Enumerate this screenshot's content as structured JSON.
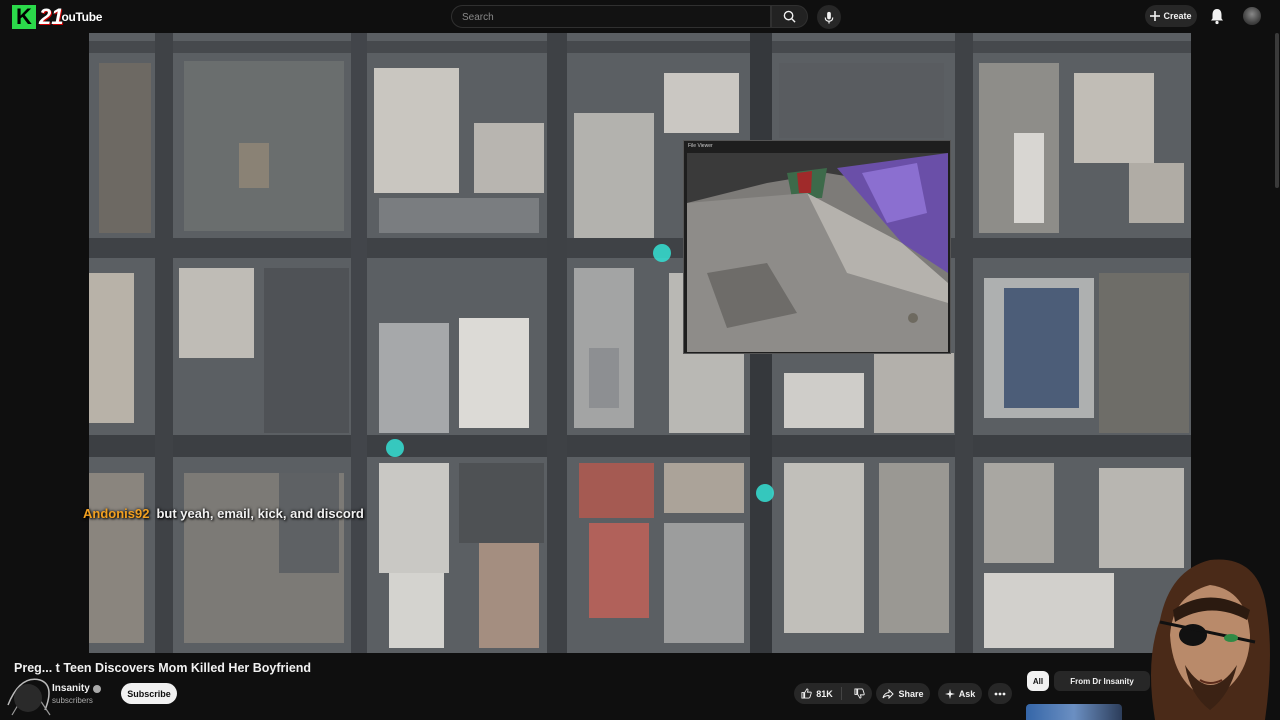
{
  "header": {
    "logo_k": "K",
    "logo_num": "21",
    "logo_text": "ouTube",
    "search_placeholder": "Search",
    "create_label": "Create"
  },
  "player": {
    "pip_title": "File Viewer",
    "chat_user": "Andonis92",
    "chat_message": "but yeah, email, kick, and discord"
  },
  "video": {
    "title": "Pregnant Teen Discovers Mom Killed Her Boyfriend",
    "title_visible": "Preg... t Teen Discovers Mom Killed Her Boyfriend",
    "channel_name": "Insanity",
    "subscribers": "subscribers",
    "subscribe_label": "Subscribe",
    "likes": "81K",
    "share_label": "Share",
    "ask_label": "Ask"
  },
  "sidebar": {
    "chips": [
      "All",
      "From Dr Insanity"
    ]
  },
  "colors": {
    "chat_user": "#f2a020",
    "kick_green": "#2bd94a",
    "map_marker": "#35e0d4"
  }
}
